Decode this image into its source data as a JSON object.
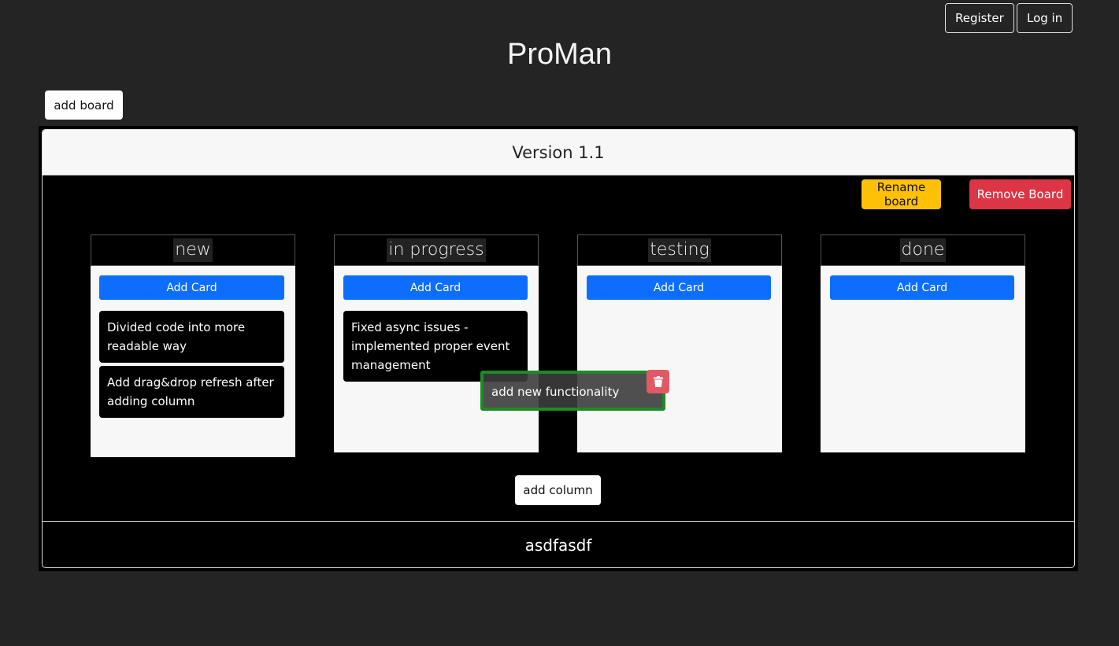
{
  "header": {
    "register_label": "Register",
    "login_label": "Log in",
    "app_title": "ProMan",
    "add_board_label": "add board"
  },
  "board": {
    "title": "Version 1.1",
    "rename_label": "Rename board",
    "remove_label": "Remove Board",
    "add_column_label": "add column",
    "footer_title": "asdfasdf",
    "columns": [
      {
        "title": "new",
        "add_card_label": "Add Card",
        "cards": [
          "Divided code into more readable way",
          "Add drag&drop refresh after adding column"
        ]
      },
      {
        "title": "in progress",
        "add_card_label": "Add Card",
        "cards": [
          "Fixed async issues - implemented proper event management"
        ]
      },
      {
        "title": "testing",
        "add_card_label": "Add Card",
        "cards": []
      },
      {
        "title": "done",
        "add_card_label": "Add Card",
        "cards": []
      }
    ]
  },
  "dragging_card": {
    "text": "add new functionality",
    "delete_icon": "trash-icon"
  },
  "colors": {
    "background": "#242424",
    "primary": "#0d6efd",
    "warning": "#ffc107",
    "danger": "#dc3545",
    "drag_outline": "#1e8a25"
  }
}
